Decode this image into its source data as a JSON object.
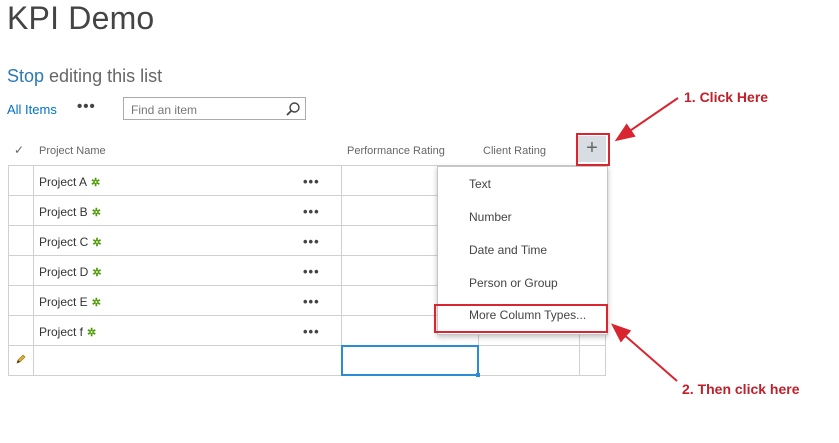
{
  "page": {
    "title": "KPI Demo",
    "edit_stop": "Stop",
    "edit_rest": " editing this list"
  },
  "toolbar": {
    "view_label": "All Items",
    "more_label": "•••",
    "search_placeholder": "Find an item"
  },
  "columns": {
    "project_name": "Project Name",
    "performance_rating": "Performance Rating",
    "client_rating": "Client Rating",
    "add_column": "+"
  },
  "rows": [
    {
      "name": "Project A",
      "new_marker": "✲"
    },
    {
      "name": "Project B",
      "new_marker": "✲"
    },
    {
      "name": "Project C",
      "new_marker": "✲"
    },
    {
      "name": "Project D",
      "new_marker": "✲"
    },
    {
      "name": "Project E",
      "new_marker": "✲"
    },
    {
      "name": "Project f",
      "new_marker": "✲"
    }
  ],
  "row_menu_label": "•••",
  "add_column_menu": {
    "items": [
      "Text",
      "Number",
      "Date and Time",
      "Person or Group",
      "More Column Types..."
    ]
  },
  "annotations": {
    "step1": "1. Click Here",
    "step2": "2. Then click here",
    "color": "#d9252f"
  },
  "icons": {
    "check": "check-icon",
    "search": "search-icon",
    "pencil": "pencil-icon"
  }
}
